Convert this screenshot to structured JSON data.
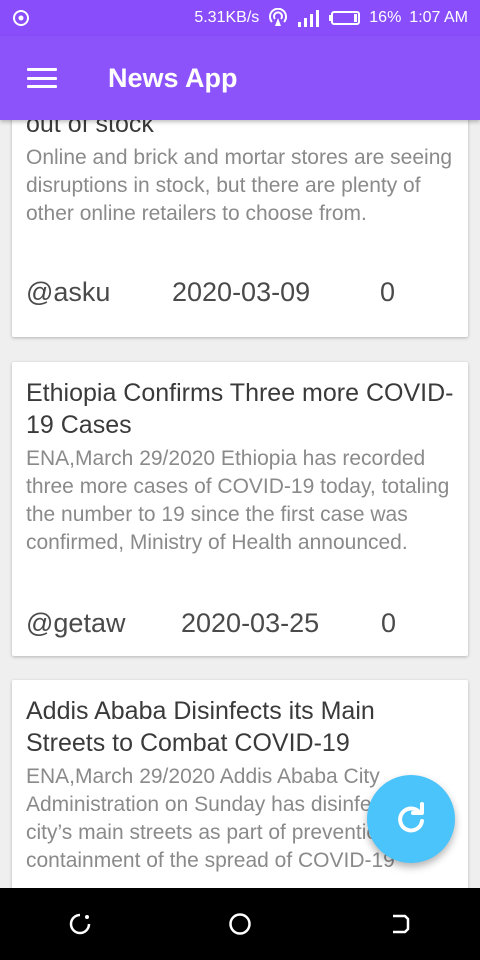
{
  "status_bar": {
    "speed": "5.31KB/s",
    "battery": "16%",
    "time": "1:07 AM",
    "left_icon": "record-icon",
    "right_icons": [
      "hotspot-icon",
      "signal-icon",
      "battery-icon"
    ]
  },
  "app_bar": {
    "title": "News App",
    "menu_icon": "hamburger-menu-icon"
  },
  "feed": {
    "items": [
      {
        "title": "out of stock",
        "body": "Online and brick and mortar stores are seeing disruptions in stock, but there are plenty of other online retailers to choose from.",
        "author": "@asku",
        "date": "2020-03-09",
        "count": "0"
      },
      {
        "title": "Ethiopia Confirms Three more COVID-19 Cases",
        "body": "ENA,March 29/2020 Ethiopia has recorded three more cases of COVID-19 today, totaling the number to 19 since the first case was confirmed, Ministry of Health announced.",
        "author": "@getaw",
        "date": "2020-03-25",
        "count": "0"
      },
      {
        "title": "Addis Ababa Disinfects its Main Streets to Combat COVID-19",
        "body": "ENA,March 29/2020 Addis Ababa City Administration on Sunday has disinfected the city’s main streets as part of prevention and containment of the spread of COVID-19"
      }
    ]
  },
  "fab": {
    "icon": "refresh-icon"
  },
  "nav_bar": {
    "icons": [
      "recent-apps-icon",
      "home-icon",
      "back-icon"
    ]
  },
  "colors": {
    "app_bar": "#8c53fb",
    "status_bar": "#8a4dfb",
    "fab": "#4ac4fb",
    "background": "#efefef"
  }
}
